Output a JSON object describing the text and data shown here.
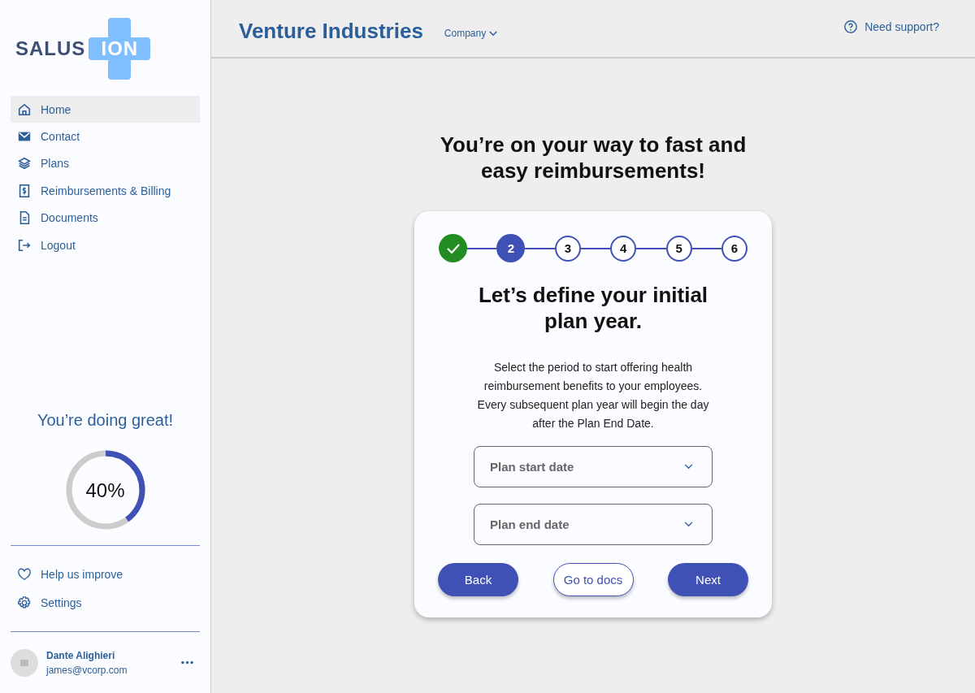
{
  "logo": {
    "part_1": "SALUS",
    "part_2": "ION"
  },
  "sidebar": {
    "items": [
      {
        "label": "Home",
        "selected": true
      },
      {
        "label": "Contact",
        "selected": false
      },
      {
        "label": "Plans",
        "selected": false
      },
      {
        "label": "Reimbursements & Billing",
        "selected": false
      },
      {
        "label": "Documents",
        "selected": false
      },
      {
        "label": "Logout",
        "selected": false
      }
    ],
    "progress": {
      "title": "You’re doing great!",
      "level": 0.4,
      "reading": "40%"
    },
    "bottom_items": [
      {
        "label": "Help us improve"
      },
      {
        "label": "Settings"
      }
    ],
    "user": {
      "name": "Dante Alighieri",
      "email": "james@vcorp.com"
    }
  },
  "header": {
    "title": "Venture Industries",
    "dropdown": "Company",
    "support": "Need support?"
  },
  "main": {
    "heading": "You’re on your way to fast and easy reimbursements!",
    "steps": [
      {
        "completed": true,
        "selected": false
      },
      {
        "label": "2",
        "completed": false,
        "selected": true
      },
      {
        "label": "3",
        "completed": false,
        "selected": false
      },
      {
        "label": "4",
        "completed": false,
        "selected": false
      },
      {
        "label": "5",
        "completed": false,
        "selected": false
      },
      {
        "label": "6",
        "completed": false,
        "selected": false
      }
    ],
    "card_title": "Let’s define your initial plan year.",
    "description": "Select the period to start offering health reimbursement benefits to your employees. Every subsequent plan year will begin the day after the Plan End Date.",
    "fields": [
      {
        "placeholder": "Plan start date"
      },
      {
        "placeholder": "Plan end date"
      }
    ],
    "buttons": [
      {
        "label": "Back",
        "kind": "filled"
      },
      {
        "label": "Go to docs",
        "kind": "outlined"
      },
      {
        "label": "Next",
        "kind": "filled"
      }
    ]
  }
}
